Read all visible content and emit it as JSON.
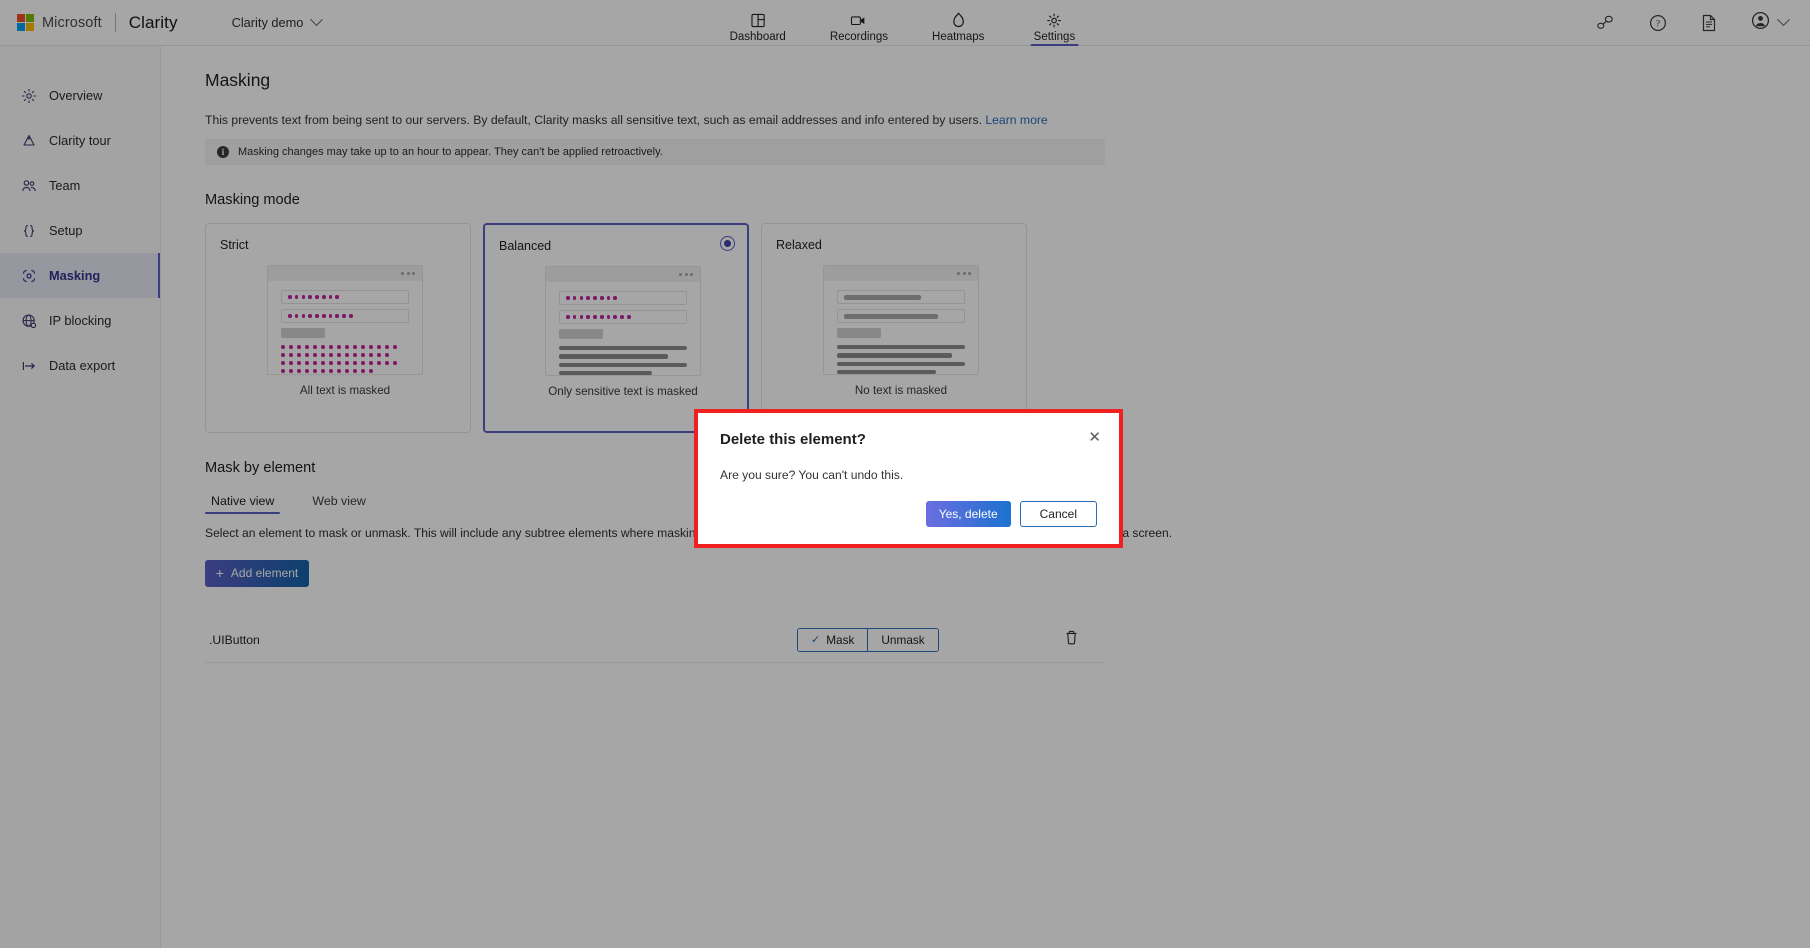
{
  "topbar": {
    "ms_label": "Microsoft",
    "product": "Clarity",
    "project": "Clarity demo",
    "nav": [
      {
        "label": "Dashboard",
        "icon": "dashboard-icon",
        "active": false
      },
      {
        "label": "Recordings",
        "icon": "recordings-icon",
        "active": false
      },
      {
        "label": "Heatmaps",
        "icon": "heatmaps-icon",
        "active": false
      },
      {
        "label": "Settings",
        "icon": "settings-gear-icon",
        "active": true
      }
    ],
    "right_icons": [
      "share-feedback-icon",
      "help-icon",
      "docs-icon",
      "account-avatar-icon"
    ]
  },
  "sidebar": {
    "items": [
      {
        "label": "Overview",
        "icon": "overview-icon",
        "selected": false
      },
      {
        "label": "Clarity tour",
        "icon": "clarity-tour-icon",
        "selected": false
      },
      {
        "label": "Team",
        "icon": "team-icon",
        "selected": false
      },
      {
        "label": "Setup",
        "icon": "setup-braces-icon",
        "selected": false
      },
      {
        "label": "Masking",
        "icon": "masking-icon",
        "selected": true
      },
      {
        "label": "IP blocking",
        "icon": "ip-blocking-icon",
        "selected": false
      },
      {
        "label": "Data export",
        "icon": "data-export-icon",
        "selected": false
      }
    ]
  },
  "main": {
    "title": "Masking",
    "description": "This prevents text from being sent to our servers. By default, Clarity masks all sensitive text, such as email addresses and info entered by users.",
    "learn_more": "Learn more",
    "info_banner": "Masking changes may take up to an hour to appear. They can't be applied retroactively.",
    "masking_mode": {
      "heading": "Masking mode",
      "selected": "Balanced",
      "cards": [
        {
          "name": "Strict",
          "caption": "All text is masked",
          "selected": false
        },
        {
          "name": "Balanced",
          "caption": "Only sensitive text is masked",
          "selected": true
        },
        {
          "name": "Relaxed",
          "caption": "No text is masked",
          "selected": false
        }
      ]
    },
    "mask_by_element": {
      "heading": "Mask by element",
      "tabs": [
        {
          "label": "Native view",
          "active": true
        },
        {
          "label": "Web view",
          "active": false
        }
      ],
      "help_line1": "Select an element to mask or unmask. This will include any subtree elements where masking or unmasking is not specified. Use *Fragment for a fragment and &Screen for a screen.",
      "add_button": "Add element",
      "rows": [
        {
          "element": ".UIButton",
          "mask_label": "Mask",
          "unmask_label": "Unmask",
          "selected": "Mask",
          "delete_icon": "trash-icon"
        }
      ]
    }
  },
  "modal": {
    "title": "Delete this element?",
    "body": "Are you sure? You can't undo this.",
    "confirm_label": "Yes, delete",
    "cancel_label": "Cancel",
    "close_icon": "close-icon",
    "highlight_color": "#ef2020"
  }
}
